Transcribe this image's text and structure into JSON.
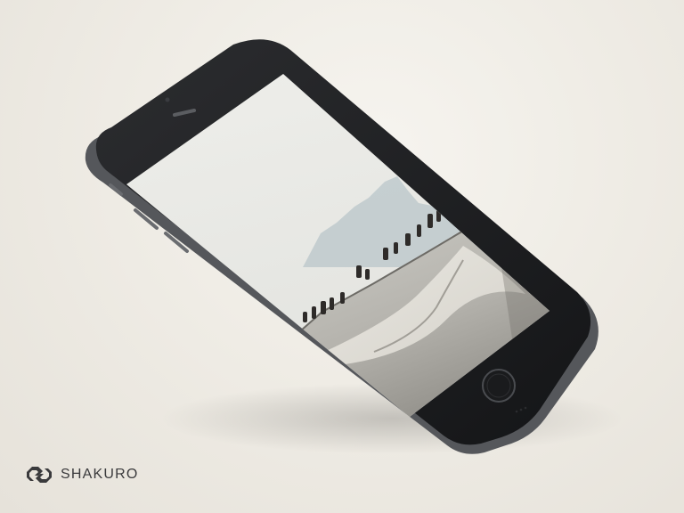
{
  "scene": {
    "subject": "phone-mockup",
    "device_color": "#1f2022",
    "background_color": "#efece5"
  },
  "brand": {
    "name": "SHAKURO",
    "logo_icon": "shakuro-logo-icon",
    "color": "#3a3a3c"
  }
}
